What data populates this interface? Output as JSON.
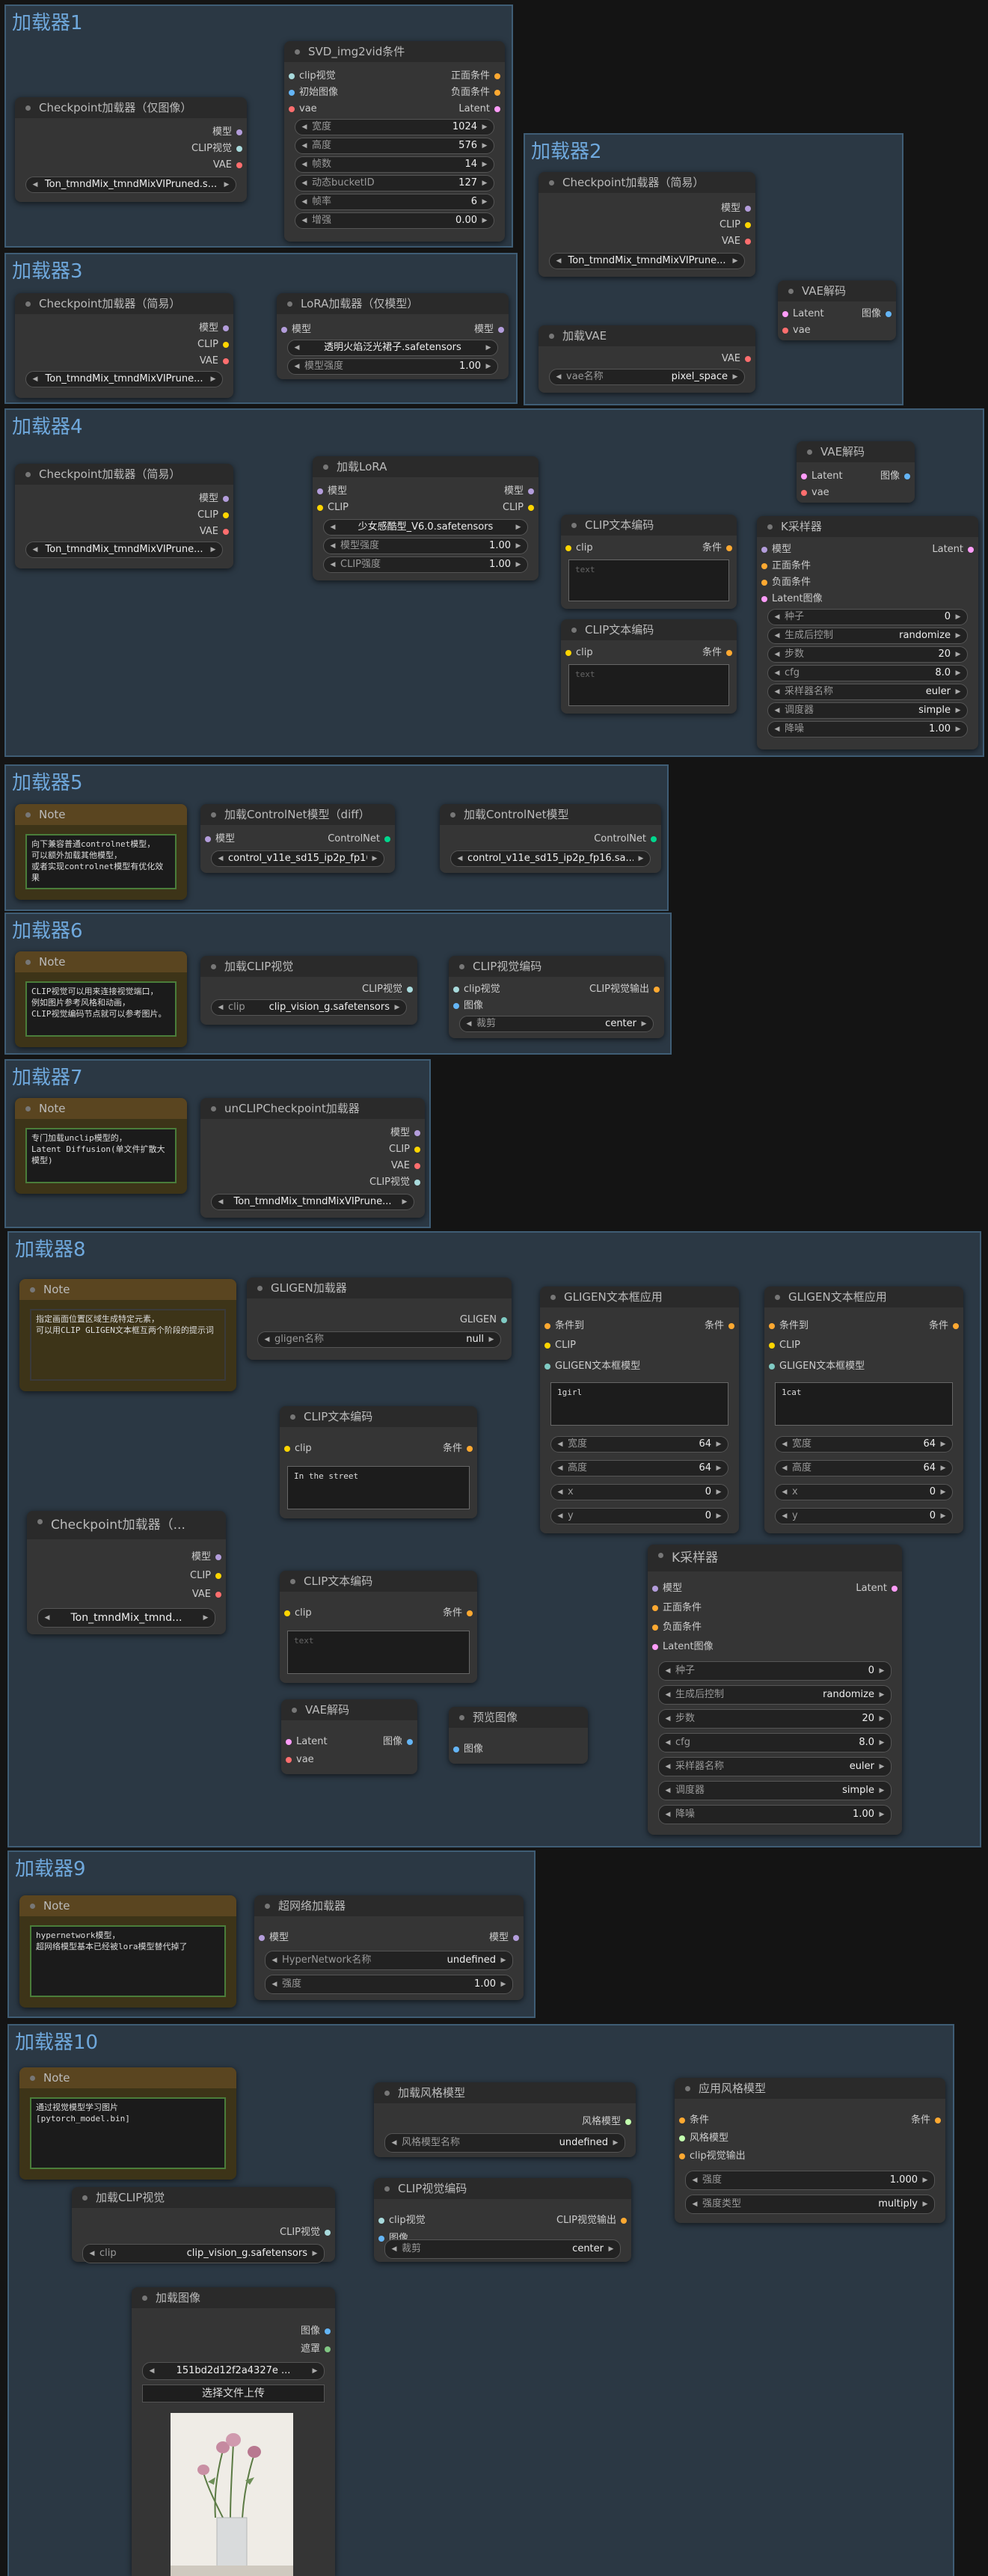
{
  "colors": {
    "model": "#b39ddb",
    "clip": "#ffd500",
    "vae": "#ff6e6e",
    "latent": "#ff9cf9",
    "conditioning": "#ffa931",
    "image": "#64b5f6",
    "clip_vision": "#a8dadc",
    "control_net": "#00d78d",
    "gligen": "#80cbc4",
    "style_model": "#c2ffae",
    "mask": "#81c784"
  },
  "groups": {
    "g1": "加载器1",
    "g2": "加载器2",
    "g3": "加载器3",
    "g4": "加载器4",
    "g5": "加载器5",
    "g6": "加载器6",
    "g7": "加载器7",
    "g8": "加载器8",
    "g9": "加载器9",
    "g10": "加载器10"
  },
  "n1a": {
    "title": "Checkpoint加载器（仅图像）",
    "out_model": "模型",
    "out_clip_vision": "CLIP视觉",
    "out_vae": "VAE",
    "ckpt": "Ton_tmndMix_tmndMixVIPruned.s..."
  },
  "n1b": {
    "title": "SVD_img2vid条件",
    "in_clip_vision": "clip视觉",
    "in_init_image": "初始图像",
    "in_vae": "vae",
    "out_positive": "正面条件",
    "out_negative": "负面条件",
    "out_latent": "Latent",
    "width_k": "宽度",
    "width_v": "1024",
    "height_k": "高度",
    "height_v": "576",
    "frames_k": "帧数",
    "frames_v": "14",
    "motion_k": "动态bucketID",
    "motion_v": "127",
    "fps_k": "帧率",
    "fps_v": "6",
    "aug_k": "增强",
    "aug_v": "0.00"
  },
  "n2a": {
    "title": "Checkpoint加载器（简易）",
    "out_model": "模型",
    "out_clip": "CLIP",
    "out_vae": "VAE",
    "ckpt": "Ton_tmndMix_tmndMixVIPrune..."
  },
  "n2b": {
    "title": "VAE解码",
    "in_latent": "Latent",
    "in_vae": "vae",
    "out_image": "图像"
  },
  "n2c": {
    "title": "加载VAE",
    "out_vae": "VAE",
    "k": "vae名称",
    "v": "pixel_space"
  },
  "n3a": {
    "title": "Checkpoint加载器（简易）",
    "out_model": "模型",
    "out_clip": "CLIP",
    "out_vae": "VAE",
    "ckpt": "Ton_tmndMix_tmndMixVIPrune..."
  },
  "n3b": {
    "title": "LoRA加载器（仅模型）",
    "in_model": "模型",
    "out_model": "模型",
    "lora": "透明火焰泛光裙子.safetensors",
    "strength_k": "模型强度",
    "strength_v": "1.00"
  },
  "n4a": {
    "title": "Checkpoint加载器（简易）",
    "out_model": "模型",
    "out_clip": "CLIP",
    "out_vae": "VAE",
    "ckpt": "Ton_tmndMix_tmndMixVIPrune..."
  },
  "n4b": {
    "title": "加载LoRA",
    "in_model": "模型",
    "in_clip": "CLIP",
    "out_model": "模型",
    "out_clip": "CLIP",
    "lora": "少女感酷型_V6.0.safetensors",
    "model_k": "模型强度",
    "model_v": "1.00",
    "clip_k": "CLIP强度",
    "clip_v": "1.00"
  },
  "n4c": {
    "title": "VAE解码",
    "in_latent": "Latent",
    "in_vae": "vae",
    "out_image": "图像"
  },
  "n4d": {
    "title": "CLIP文本编码",
    "in_clip": "clip",
    "out_cond": "条件",
    "text": "text"
  },
  "n4e": {
    "title": "CLIP文本编码",
    "in_clip": "clip",
    "out_cond": "条件",
    "text": "text"
  },
  "n4f": {
    "title": "K采样器",
    "in_model": "模型",
    "in_pos": "正面条件",
    "in_neg": "负面条件",
    "in_latent": "Latent图像",
    "out_latent": "Latent",
    "seed_k": "种子",
    "seed_v": "0",
    "ctrl_k": "生成后控制",
    "ctrl_v": "randomize",
    "steps_k": "步数",
    "steps_v": "20",
    "cfg_k": "cfg",
    "cfg_v": "8.0",
    "sampler_k": "采样器名称",
    "sampler_v": "euler",
    "sched_k": "调度器",
    "sched_v": "simple",
    "denoise_k": "降噪",
    "denoise_v": "1.00"
  },
  "n5a": {
    "title": "Note",
    "text": "向下兼容普通controlnet模型，\n可以额外加载其他模型，\n或者实现controlnet模型有优化效果"
  },
  "n5b": {
    "title": "加载ControlNet模型（diff）",
    "in_model": "模型",
    "out_cn": "ControlNet",
    "cn": "control_v11e_sd15_ip2p_fp16.saf..."
  },
  "n5c": {
    "title": "加载ControlNet模型",
    "out_cn": "ControlNet",
    "cn": "control_v11e_sd15_ip2p_fp16.sa..."
  },
  "n6a": {
    "title": "Note",
    "text": "CLIP视觉可以用来连接视觉端口，\n例如图片参考风格和动画，\nCLIP视觉编码节点就可以参考图片。"
  },
  "n6b": {
    "title": "加载CLIP视觉",
    "out": "CLIP视觉",
    "k": "clip",
    "v": "clip_vision_g.safetensors"
  },
  "n6c": {
    "title": "CLIP视觉编码",
    "in_cv": "clip视觉",
    "in_image": "图像",
    "out": "CLIP视觉输出",
    "crop_k": "裁剪",
    "crop_v": "center"
  },
  "n7a": {
    "title": "Note",
    "text": "专门加载unclip模型的，\nLatent Diffusion(单文件扩散大模型)"
  },
  "n7b": {
    "title": "unCLIPCheckpoint加载器",
    "out_model": "模型",
    "out_clip": "CLIP",
    "out_vae": "VAE",
    "out_cv": "CLIP视觉",
    "ckpt": "Ton_tmndMix_tmndMixVIPrune..."
  },
  "n8a": {
    "title": "Note",
    "text": "指定画面位置区域生成特定元素，\n可以用CLIP GLIGEN文本框互两个阶段的提示词"
  },
  "n8b": {
    "title": "GLIGEN加载器",
    "out": "GLIGEN",
    "k": "gligen名称",
    "v": "null"
  },
  "n8c": {
    "title": "GLIGEN文本框应用",
    "in_cond": "条件到",
    "in_clip": "CLIP",
    "in_gligen": "GLIGEN文本框模型",
    "out_cond": "条件",
    "text": "1girl",
    "width_k": "宽度",
    "width_v": "64",
    "height_k": "高度",
    "height_v": "64",
    "x_k": "x",
    "x_v": "0",
    "y_k": "y",
    "y_v": "0"
  },
  "n8d": {
    "title": "GLIGEN文本框应用",
    "in_cond": "条件到",
    "in_clip": "CLIP",
    "in_gligen": "GLIGEN文本框模型",
    "out_cond": "条件",
    "text": "1cat",
    "width_k": "宽度",
    "width_v": "64",
    "height_k": "高度",
    "height_v": "64",
    "x_k": "x",
    "x_v": "0",
    "y_k": "y",
    "y_v": "0"
  },
  "n8e": {
    "title": "CLIP文本编码",
    "in_clip": "clip",
    "out_cond": "条件",
    "text": "In the street"
  },
  "n8f": {
    "title": "Checkpoint加载器（...",
    "out_model": "模型",
    "out_clip": "CLIP",
    "out_vae": "VAE",
    "ckpt": "Ton_tmndMix_tmnd..."
  },
  "n8g": {
    "title": "CLIP文本编码",
    "in_clip": "clip",
    "out_cond": "条件",
    "text": "text"
  },
  "n8h": {
    "title": "K采样器",
    "in_model": "模型",
    "in_pos": "正面条件",
    "in_neg": "负面条件",
    "in_latent": "Latent图像",
    "out_latent": "Latent",
    "seed_k": "种子",
    "seed_v": "0",
    "ctrl_k": "生成后控制",
    "ctrl_v": "randomize",
    "steps_k": "步数",
    "steps_v": "20",
    "cfg_k": "cfg",
    "cfg_v": "8.0",
    "sampler_k": "采样器名称",
    "sampler_v": "euler",
    "sched_k": "调度器",
    "sched_v": "simple",
    "denoise_k": "降噪",
    "denoise_v": "1.00"
  },
  "n8i": {
    "title": "VAE解码",
    "in_latent": "Latent",
    "in_vae": "vae",
    "out_image": "图像"
  },
  "n8j": {
    "title": "预览图像",
    "in_image": "图像"
  },
  "n9a": {
    "title": "Note",
    "text": "hypernetwork模型，\n超网络模型基本已经被lora模型替代掉了"
  },
  "n9b": {
    "title": "超网络加载器",
    "in_model": "模型",
    "out_model": "模型",
    "name_k": "HyperNetwork名称",
    "name_v": "undefined",
    "str_k": "强度",
    "str_v": "1.00"
  },
  "n10a": {
    "title": "Note",
    "text": "通过视觉模型学习图片\n[pytorch_model.bin]"
  },
  "n10b": {
    "title": "加载风格模型",
    "out": "风格模型",
    "k": "风格模型名称",
    "v": "undefined"
  },
  "n10c": {
    "title": "应用风格模型",
    "in_cond": "条件",
    "in_style": "风格模型",
    "in_cvo": "clip视觉输出",
    "out_cond": "条件",
    "str_k": "强度",
    "str_v": "1.000",
    "type_k": "强度类型",
    "type_v": "multiply"
  },
  "n10d": {
    "title": "加载CLIP视觉",
    "out": "CLIP视觉",
    "k": "clip",
    "v": "clip_vision_g.safetensors"
  },
  "n10e": {
    "title": "CLIP视觉编码",
    "in_cv": "clip视觉",
    "in_image": "图像",
    "out": "CLIP视觉输出",
    "crop_k": "裁剪",
    "crop_v": "center"
  },
  "n10f": {
    "title": "加载图像",
    "out_image": "图像",
    "out_mask": "遮罩",
    "image": "151bd2d12f2a4327e ...",
    "upload": "选择文件上传"
  }
}
